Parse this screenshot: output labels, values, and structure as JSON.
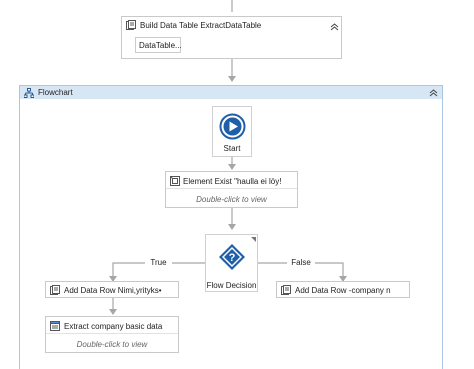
{
  "build_activity": {
    "title": "Build Data Table ExtractDataTable",
    "field_value": "DataTable...",
    "collapse_icon": "double-chevron-up"
  },
  "flowchart": {
    "title": "Flowchart",
    "collapse_icon": "double-chevron-up"
  },
  "start_node": {
    "label": "Start",
    "icon": "play-circle"
  },
  "element_exists": {
    "title": "Element Exist \"haulla ei löy!",
    "hint": "Double-click to view"
  },
  "flow_decision": {
    "label": "Flow Decision",
    "icon": "question-diamond",
    "true_label": "True",
    "false_label": "False"
  },
  "add_row_true": {
    "title": "Add Data Row Nimi,yrityks•"
  },
  "add_row_false": {
    "title": "Add Data Row -company n"
  },
  "extract_activity": {
    "title": "Extract company basic data",
    "hint": "Double-click to view"
  },
  "colors": {
    "accent": "#1f5fa8",
    "header_bg": "#d6e6f5",
    "border": "#a9c6e3",
    "connector": "#9aa0a6"
  }
}
